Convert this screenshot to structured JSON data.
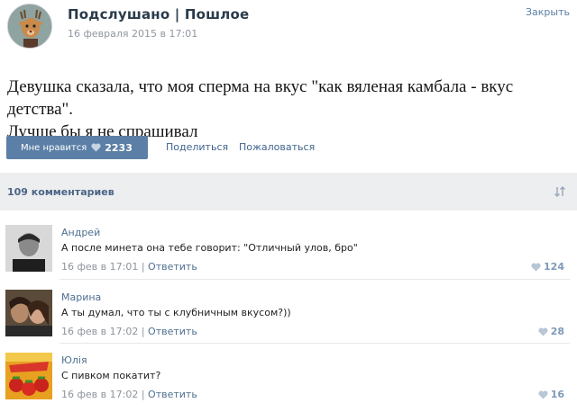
{
  "post": {
    "group_name": "Подслушано | Пошлое",
    "date": "16 февраля 2015 в 17:01",
    "close_label": "Закрыть",
    "text_line1": "Девушка сказала, что моя сперма на вкус \"как вяленая камбала - вкус детства\".",
    "text_line2": "Лучше бы я не спрашивал"
  },
  "actions": {
    "like_label": "Мне нравится",
    "like_count": "2233",
    "share_label": "Поделиться",
    "report_label": "Пожаловаться"
  },
  "comments_header": {
    "count_label": "109 комментариев"
  },
  "comments": [
    {
      "author": "Андрей",
      "text": "А после минета она тебе говорит: \"Отличный улов, бро\"",
      "date": "16 фев в 17:01",
      "sep": "|",
      "reply_label": "Ответить",
      "likes": "124"
    },
    {
      "author": "Марина",
      "text": "А ты думал, что ты с клубничным вкусом?))",
      "date": "16 фев в 17:02",
      "sep": "|",
      "reply_label": "Ответить",
      "likes": "28"
    },
    {
      "author": "Юлія",
      "text": "С пивком покатит?",
      "date": "16 фев в 17:02",
      "sep": "|",
      "reply_label": "Ответить",
      "likes": "16"
    }
  ],
  "icons": {
    "heart": "heart-icon",
    "sort": "sort-icon"
  },
  "colors": {
    "accent": "#5b7fa6",
    "link": "#41648e",
    "bar_bg": "#edeef0"
  }
}
